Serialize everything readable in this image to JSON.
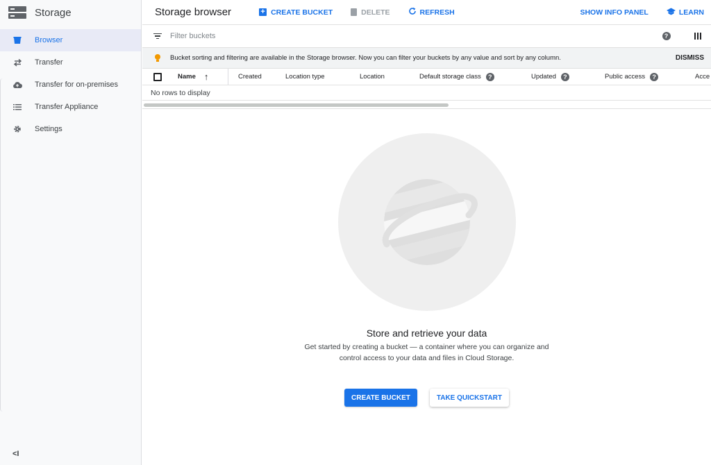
{
  "app": {
    "title": "Storage"
  },
  "sidebar": {
    "items": [
      {
        "label": "Browser",
        "icon": "bucket-icon",
        "active": true
      },
      {
        "label": "Transfer",
        "icon": "transfer-arrows-icon",
        "active": false
      },
      {
        "label": "Transfer for on-premises",
        "icon": "cloud-upload-icon",
        "active": false
      },
      {
        "label": "Transfer Appliance",
        "icon": "appliance-list-icon",
        "active": false
      },
      {
        "label": "Settings",
        "icon": "gear-icon",
        "active": false
      }
    ],
    "collapse_label": "<I"
  },
  "toolbar": {
    "page_title": "Storage browser",
    "create_bucket": "CREATE BUCKET",
    "delete": "DELETE",
    "refresh": "REFRESH",
    "show_info_panel": "SHOW INFO PANEL",
    "learn": "LEARN"
  },
  "filter": {
    "placeholder": "Filter buckets"
  },
  "banner": {
    "text": "Bucket sorting and filtering are available in the Storage browser. Now you can filter your buckets by any value and sort by any column.",
    "dismiss": "DISMISS"
  },
  "table": {
    "columns": [
      "Name",
      "Created",
      "Location type",
      "Location",
      "Default storage class",
      "Updated",
      "Public access",
      "Acce"
    ],
    "sort_arrow": "↑",
    "empty_message": "No rows to display"
  },
  "empty_state": {
    "title": "Store and retrieve your data",
    "description": "Get started by creating a bucket — a container where you can organize and control access to your data and files in Cloud Storage.",
    "primary_button": "CREATE BUCKET",
    "secondary_button": "TAKE QUICKSTART"
  },
  "colors": {
    "accent": "#1a73e8",
    "warning": "#f29900"
  }
}
